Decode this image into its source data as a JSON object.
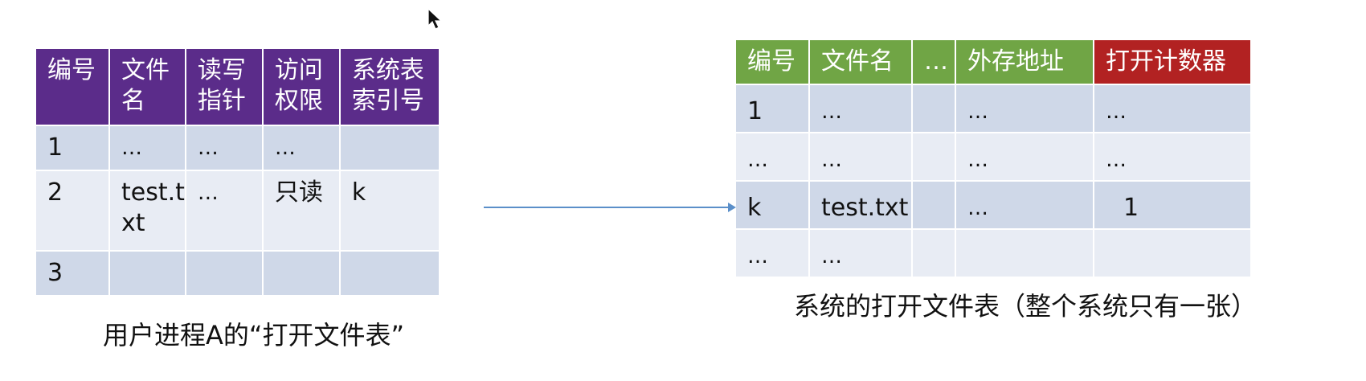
{
  "user_table": {
    "caption": "用户进程A的“打开文件表”",
    "headers": [
      "编号",
      "文件\n名",
      "读写\n指针",
      "访问\n权限",
      "系统表\n索引号"
    ],
    "rows": [
      [
        "1",
        "…",
        "…",
        "…",
        ""
      ],
      [
        "2",
        "test.t\nxt",
        "…",
        "只读",
        "k"
      ],
      [
        "3",
        "",
        "",
        "",
        ""
      ]
    ]
  },
  "system_table": {
    "caption": "系统的打开文件表（整个系统只有一张）",
    "headers": [
      "编号",
      "文件名",
      "…",
      "外存地址",
      "打开计数器"
    ],
    "rows": [
      [
        "1",
        "…",
        "",
        "…",
        "…"
      ],
      [
        "…",
        "…",
        "",
        "…",
        "…"
      ],
      [
        "k",
        "test.txt",
        "",
        "…",
        " 1"
      ],
      [
        "…",
        "…",
        "",
        "",
        ""
      ]
    ]
  },
  "colors": {
    "user_header": "#5b2c8a",
    "system_header": "#70a545",
    "counter_header": "#b22222",
    "row_dark": "#cfd8e8",
    "row_light": "#e8ecf4",
    "arrow": "#5b8fc9"
  }
}
